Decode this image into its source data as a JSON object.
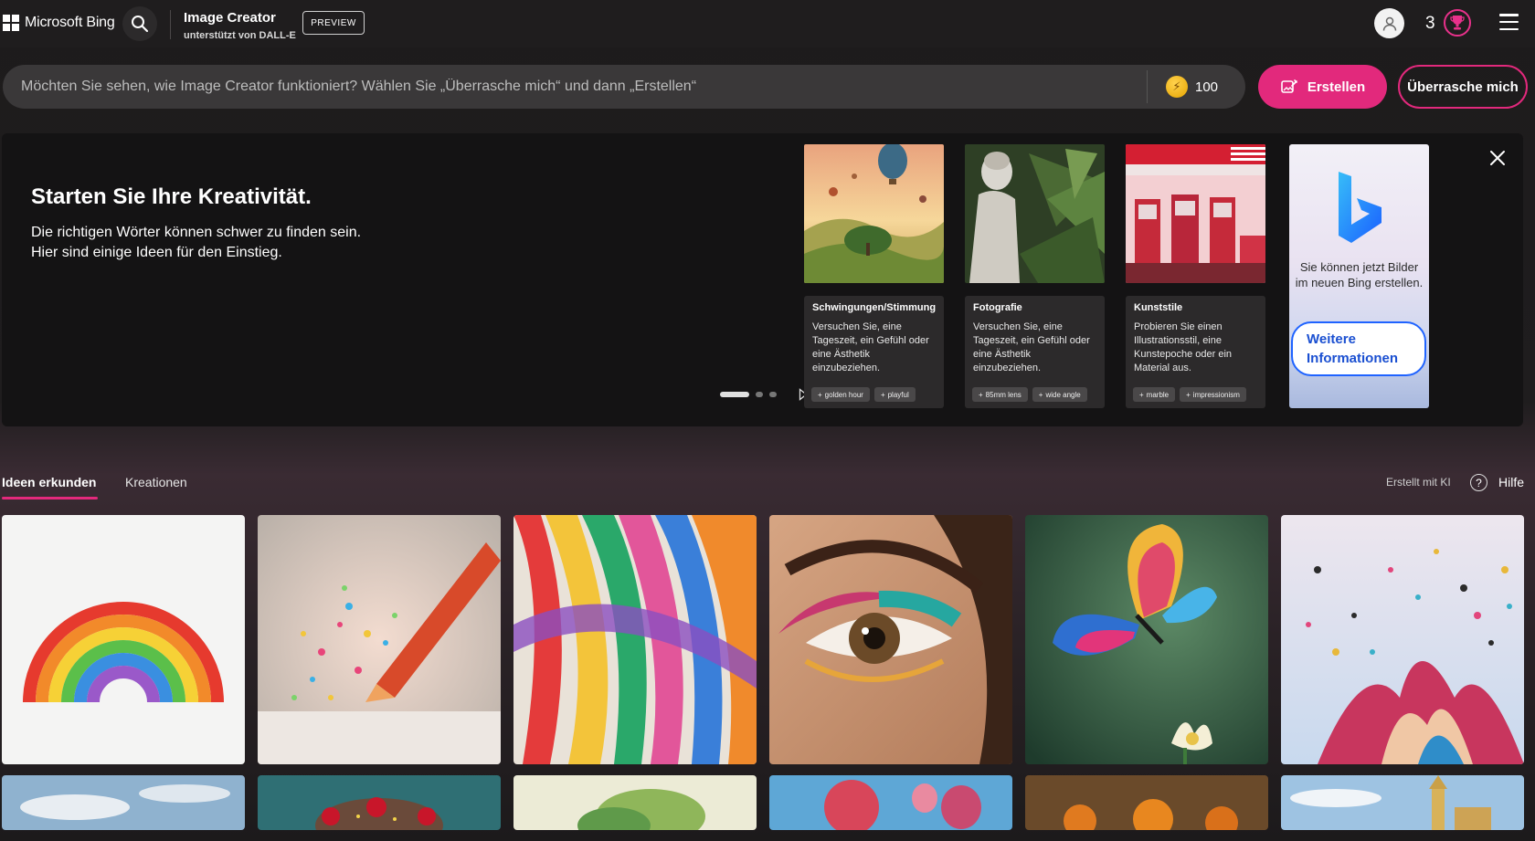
{
  "header": {
    "brand": "Microsoft Bing",
    "app_title": "Image Creator",
    "app_subtitle": "unterstützt von DALL-E",
    "preview_badge": "PREVIEW",
    "reward_count": "3"
  },
  "prompt": {
    "placeholder": "Möchten Sie sehen, wie Image Creator funktioniert? Wählen Sie „Überrasche mich“ und dann „Erstellen“",
    "boosts": "100",
    "create_label": "Erstellen",
    "surprise_label": "Überrasche mich"
  },
  "banner": {
    "title": "Starten Sie Ihre Kreativität.",
    "line1": "Die richtigen Wörter können schwer zu finden sein.",
    "line2": "Hier sind einige Ideen für den Einstieg.",
    "cards": [
      {
        "category": "Schwingungen/Stimmung",
        "description": "Versuchen Sie, eine Tageszeit, ein Gefühl oder eine Ästhetik einzubeziehen.",
        "tags": [
          "golden hour",
          "playful"
        ]
      },
      {
        "category": "Fotografie",
        "description": "Versuchen Sie, eine Tageszeit, ein Gefühl oder eine Ästhetik einzubeziehen.",
        "tags": [
          "85mm lens",
          "wide angle"
        ]
      },
      {
        "category": "Kunststile",
        "description": "Probieren Sie einen Illustrationsstil, eine Kunstepoche oder ein Material aus.",
        "tags": [
          "marble",
          "impressionism"
        ]
      }
    ],
    "promo": {
      "text": "Sie können jetzt Bilder im neuen Bing erstellen.",
      "button_line1": "Weitere",
      "button_line2": "Informationen"
    }
  },
  "tabs": {
    "explore": "Ideen erkunden",
    "creations": "Kreationen",
    "made_with_ai": "Erstellt mit KI",
    "help": "Hilfe"
  },
  "icons": {
    "search": "search-icon",
    "profile": "user-icon",
    "rewards": "trophy-icon",
    "menu": "hamburger-icon",
    "create": "image-create-icon",
    "close": "close-icon"
  },
  "colors": {
    "accent": "#e2297c",
    "background": "#1f1d1e",
    "link_blue": "#1f63ff"
  }
}
